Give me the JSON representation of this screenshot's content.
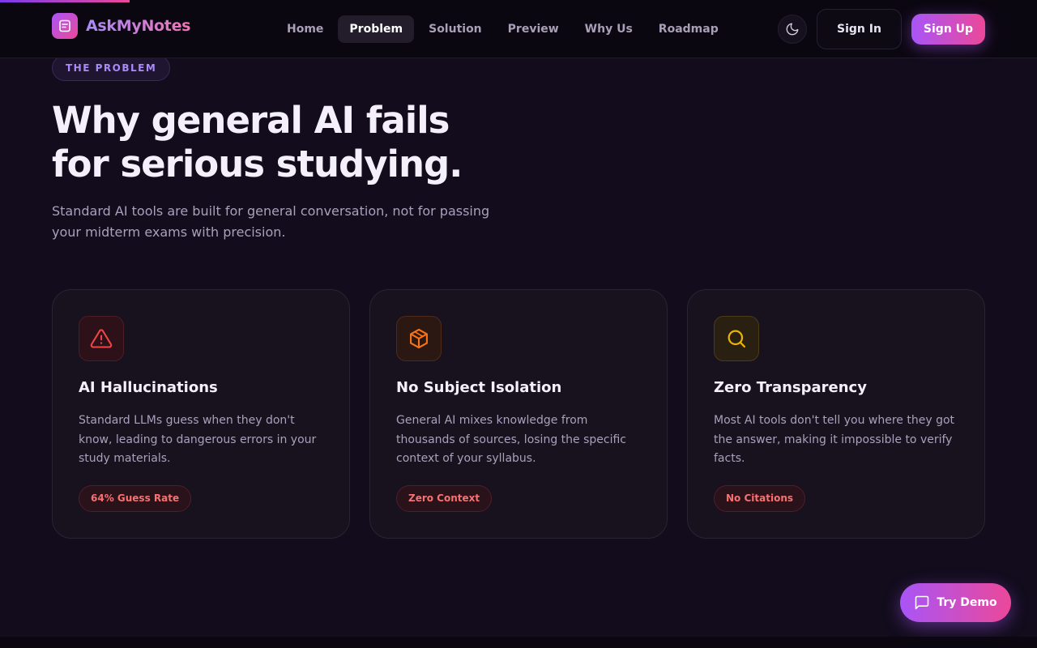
{
  "brand": {
    "name": "AskMyNotes",
    "icon": "notes-icon"
  },
  "nav": {
    "links": [
      {
        "label": "Home",
        "active": false
      },
      {
        "label": "Problem",
        "active": true
      },
      {
        "label": "Solution",
        "active": false
      },
      {
        "label": "Preview",
        "active": false
      },
      {
        "label": "Why Us",
        "active": false
      },
      {
        "label": "Roadmap",
        "active": false
      }
    ],
    "theme_icon": "moon-icon",
    "sign_in": "Sign In",
    "sign_up": "Sign Up"
  },
  "hero": {
    "eyebrow": "THE PROBLEM",
    "headline_line1": "Why general AI fails",
    "headline_line2": "for serious studying.",
    "subtext": "Standard AI tools are built for general conversation, not for passing your midterm exams with precision."
  },
  "cards": [
    {
      "icon": "warning-triangle-icon",
      "accent": "#ef4444",
      "title": "AI Hallucinations",
      "description": "Standard LLMs guess when they don't know, leading to dangerous errors in your study materials.",
      "badge": "64% Guess Rate"
    },
    {
      "icon": "cube-icon",
      "accent": "#f97316",
      "title": "No Subject Isolation",
      "description": "General AI mixes knowledge from thousands of sources, losing the specific context of your syllabus.",
      "badge": "Zero Context"
    },
    {
      "icon": "search-icon",
      "accent": "#eab308",
      "title": "Zero Transparency",
      "description": "Most AI tools don't tell you where they got the answer, making it impossible to verify facts.",
      "badge": "No Citations"
    }
  ],
  "try_demo": {
    "label": "Try Demo",
    "icon": "chat-bubble-icon"
  },
  "colors": {
    "background": "#120c1c",
    "accent_start": "#a855f7",
    "accent_end": "#ec4899",
    "badge_text": "#f87171"
  }
}
